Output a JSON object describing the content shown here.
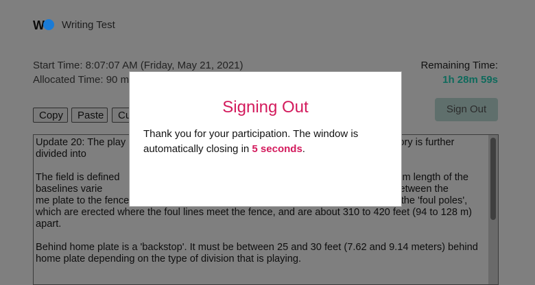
{
  "header": {
    "logo_text": "W",
    "app_title": "Writing Test"
  },
  "session": {
    "start_time": "Start Time: 8:07:07 AM (Friday, May 21, 2021)",
    "allocated_time": "Allocated Time: 90 m",
    "remaining_label": "Remaining Time:",
    "remaining_value": "1h 28m 59s"
  },
  "toolbar": {
    "copy_label": "Copy",
    "paste_label": "Paste",
    "cut_label": "Cu"
  },
  "signout_button_label": "Sign Out",
  "editor": {
    "paragraphs": [
      "Update 20: The play                                                                                        ir territory is further divided into                                                                                outfield fence.",
      "The field is defined                                                                                       e minimum length of the baselines varie                                                                       nts). A fence running between the                                                                         me plate to the fence varies by field. The width of the field is the distance between the 'foul poles', which are erected where the foul lines meet the fence, and are about 310 to 420 feet (94 to 128 m) apart.",
      "Behind home plate is a 'backstop'. It must be between 25 and 30 feet (7.62 and 9.14 meters) behind home plate depending on the type of division that is playing."
    ]
  },
  "dialog": {
    "title": "Signing Out",
    "message_before": "Thank you for your participation. The window is automatically closing in ",
    "countdown": "5 seconds",
    "message_after": "."
  },
  "colors": {
    "accent_pink": "#d31a5c",
    "remaining_green": "#0e6a5c"
  }
}
